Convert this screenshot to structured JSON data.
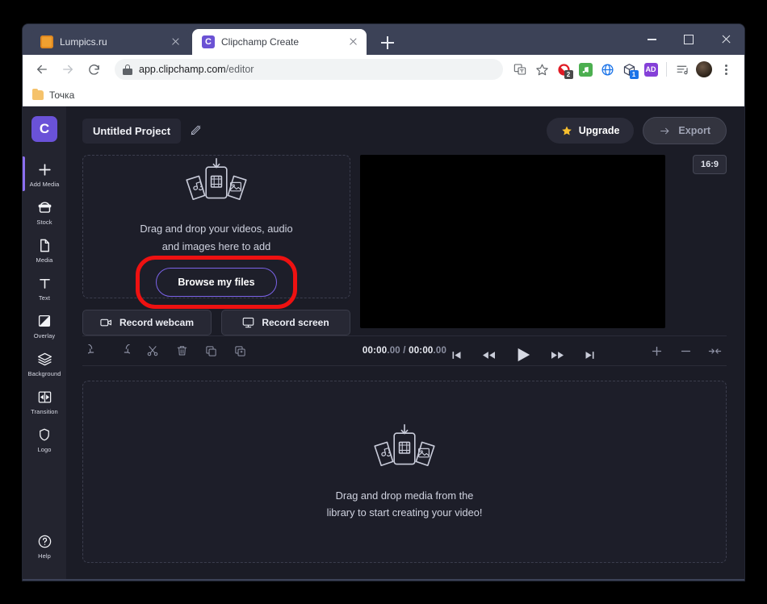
{
  "browser": {
    "tabs": [
      {
        "title": "Lumpics.ru",
        "favicon": "orange-circle-icon",
        "active": false
      },
      {
        "title": "Clipchamp Create",
        "favicon": "clipchamp-c-icon",
        "active": true
      }
    ],
    "new_tab_label": "+",
    "window_controls": {
      "minimize": "minimize-icon",
      "maximize": "maximize-icon",
      "close": "close-icon"
    },
    "url_secure": "app.clipchamp.com",
    "url_path": "/editor",
    "extensions": [
      {
        "name": "translate-icon",
        "color": "#5f6368",
        "badge": ""
      },
      {
        "name": "bookmark-star-icon",
        "color": "#5f6368",
        "badge": ""
      },
      {
        "name": "adblock-icon",
        "color": "#e01b24",
        "badge": "2"
      },
      {
        "name": "music-extension-icon",
        "color": "#4caf50",
        "badge": ""
      },
      {
        "name": "globe-extension-icon",
        "color": "#1a73e8",
        "badge": ""
      },
      {
        "name": "package-extension-icon",
        "color": "#3c4257",
        "badge": "1"
      },
      {
        "name": "purple-extension-icon",
        "color": "#8540d8",
        "badge": ""
      },
      {
        "name": "reading-list-icon",
        "color": "#5f6368",
        "badge": ""
      }
    ],
    "bookmarks": [
      {
        "label": "Точка",
        "icon": "folder-icon"
      }
    ]
  },
  "sidebar": {
    "brand": "C",
    "items": [
      {
        "label": "Add Media",
        "icon": "plus-icon",
        "active": true
      },
      {
        "label": "Stock",
        "icon": "stock-icon",
        "active": false
      },
      {
        "label": "Media",
        "icon": "file-icon",
        "active": false
      },
      {
        "label": "Text",
        "icon": "text-t-icon",
        "active": false
      },
      {
        "label": "Overlay",
        "icon": "overlay-icon",
        "active": false
      },
      {
        "label": "Background",
        "icon": "layers-icon",
        "active": false
      },
      {
        "label": "Transition",
        "icon": "transition-icon",
        "active": false
      },
      {
        "label": "Logo",
        "icon": "shield-icon",
        "active": false
      }
    ],
    "help": {
      "label": "Help",
      "icon": "question-circle-icon"
    }
  },
  "appbar": {
    "project_name": "Untitled Project",
    "rename_icon": "pen-icon",
    "upgrade_label": "Upgrade",
    "upgrade_icon": "star-icon",
    "export_label": "Export",
    "export_icon": "arrow-right-icon"
  },
  "dropzone": {
    "line1": "Drag and drop your videos, audio",
    "line2": "and images here to add",
    "browse_label": "Browse my files",
    "media_icon": "media-cards-icon",
    "highlight_color": "#ee1111"
  },
  "record": {
    "webcam_label": "Record webcam",
    "webcam_icon": "video-camera-icon",
    "screen_label": "Record screen",
    "screen_icon": "monitor-icon"
  },
  "preview": {
    "aspect_ratio": "16:9",
    "controls": [
      {
        "name": "skip-start-icon"
      },
      {
        "name": "rewind-icon"
      },
      {
        "name": "play-icon"
      },
      {
        "name": "fast-forward-icon"
      },
      {
        "name": "skip-end-icon"
      }
    ]
  },
  "timeline_toolbar": {
    "left_tools": [
      {
        "name": "undo-icon"
      },
      {
        "name": "redo-icon"
      },
      {
        "name": "split-scissors-icon"
      },
      {
        "name": "delete-trash-icon"
      },
      {
        "name": "duplicate-icon"
      },
      {
        "name": "copy-add-icon"
      }
    ],
    "current_time": "00:00",
    "current_frac": ".00",
    "separator": " / ",
    "total_time": "00:00",
    "total_frac": ".00",
    "right_tools": [
      {
        "name": "zoom-in-icon"
      },
      {
        "name": "zoom-out-icon"
      },
      {
        "name": "fit-to-screen-icon"
      }
    ]
  },
  "timeline": {
    "line1": "Drag and drop media from the",
    "line2": "library to start creating your video!",
    "media_icon": "media-cards-icon"
  },
  "colors": {
    "accent_purple": "#6a52d8",
    "app_bg": "#1b1c26",
    "panel_bg": "#1d1e29",
    "sidebar_bg": "#23242f",
    "highlight_red": "#ee1111",
    "star_gold": "#f7bf2e"
  }
}
